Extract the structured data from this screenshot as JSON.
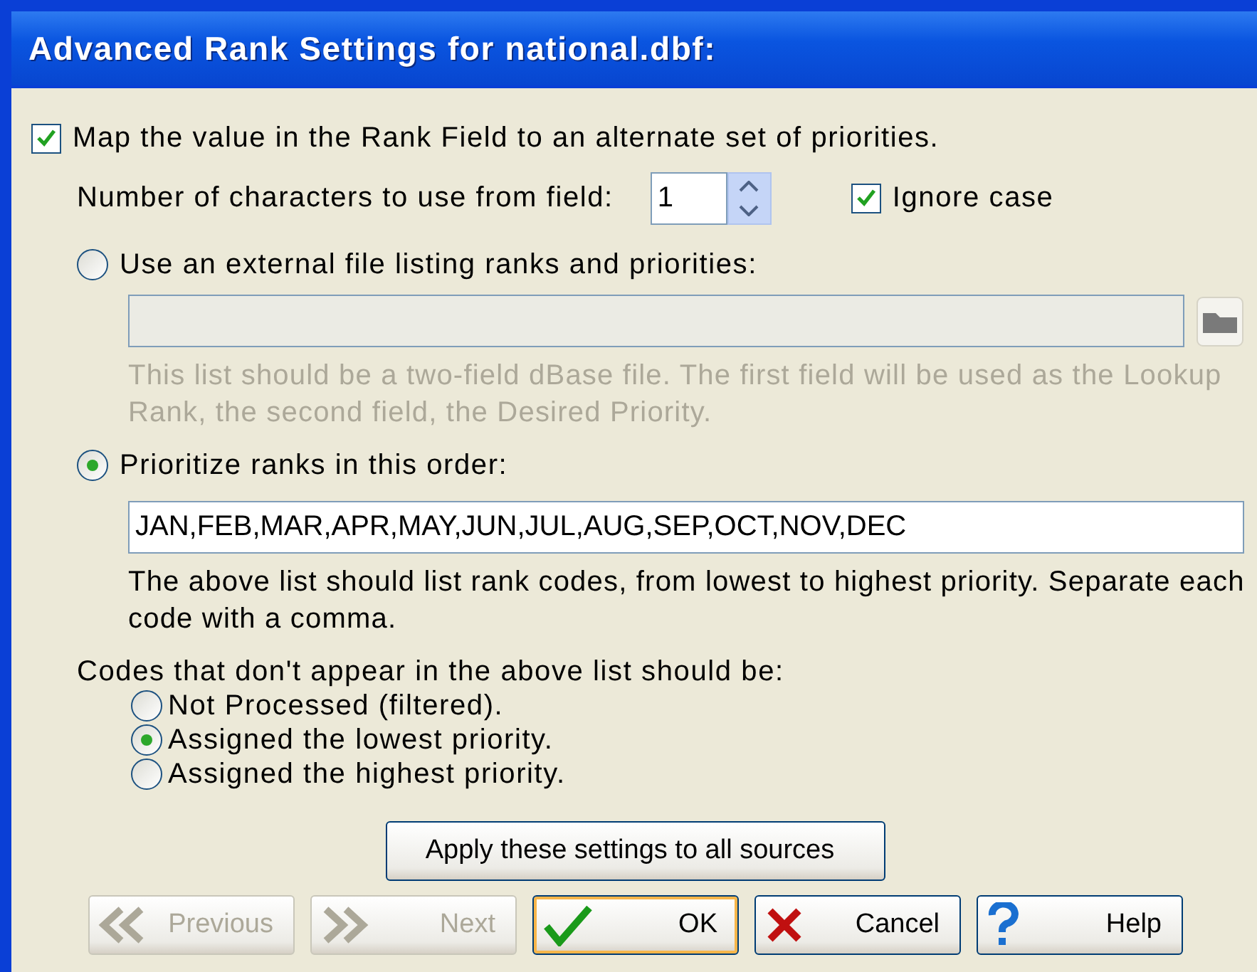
{
  "window": {
    "title": "Advanced Rank Settings for national.dbf:"
  },
  "map_option": {
    "label": "Map the value in the Rank Field to an alternate set of priorities.",
    "checked": true
  },
  "characters": {
    "label": "Number of characters to use from field:",
    "value": "1"
  },
  "ignore_case": {
    "label": "Ignore case",
    "checked": true
  },
  "source_options": [
    {
      "kind": "file",
      "label": "Use an external file listing ranks and priorities:",
      "selected": false,
      "disabled": true,
      "note": "This list should be a two-field dBase file. The first field will be used as the Lookup Rank, the second field, the Desired Priority."
    },
    {
      "kind": "list",
      "label": "Prioritize ranks in this order:",
      "selected": true,
      "disabled": false,
      "value_field": {
        "value": "JAN,FEB,MAR,APR,MAY,JUN,JUL,AUG,SEP,OCT,NOV,DEC"
      },
      "note": "The above list should list rank codes, from lowest to highest priority. Separate each code with a comma."
    }
  ],
  "missing_codes": {
    "label": "Codes that don't appear in the above list should be:",
    "options": [
      {
        "label": "Not Processed (filtered).",
        "selected": false
      },
      {
        "label": "Assigned the lowest priority.",
        "selected": true
      },
      {
        "label": "Assigned the highest priority.",
        "selected": false
      }
    ]
  },
  "apply_button": "Apply these settings to all sources",
  "buttons": [
    {
      "kind": "previous",
      "label": "Previous",
      "disabled": true,
      "default": false
    },
    {
      "kind": "next",
      "label": "Next",
      "disabled": true,
      "default": false
    },
    {
      "kind": "ok",
      "label": "OK",
      "disabled": false,
      "default": true
    },
    {
      "kind": "cancel",
      "label": "Cancel",
      "disabled": false,
      "default": false
    },
    {
      "kind": "help",
      "label": "Help",
      "disabled": false,
      "default": false
    }
  ]
}
